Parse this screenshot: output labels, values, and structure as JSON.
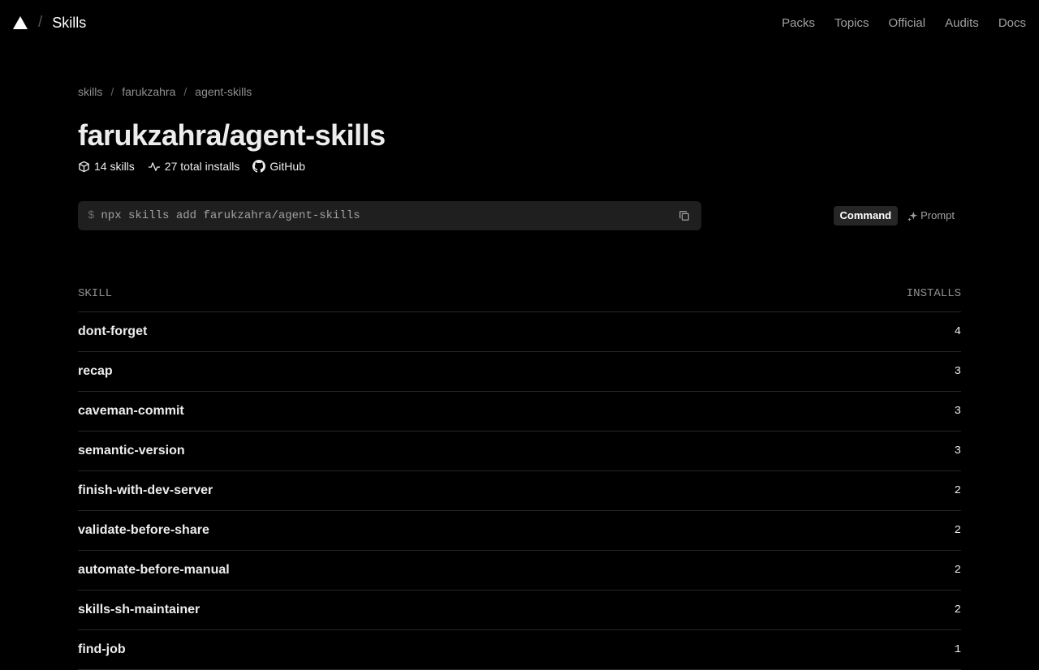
{
  "header": {
    "brand_sep": "/",
    "brand_name": "Skills",
    "nav": [
      "Packs",
      "Topics",
      "Official",
      "Audits",
      "Docs"
    ]
  },
  "breadcrumb": {
    "items": [
      "skills",
      "farukzahra",
      "agent-skills"
    ],
    "sep": "/"
  },
  "repo": {
    "title": "farukzahra/agent-skills",
    "skills_count": "14 skills",
    "installs": "27 total installs",
    "github_label": "GitHub"
  },
  "command": {
    "prompt_symbol": "$",
    "text": "npx skills add farukzahra/agent-skills"
  },
  "mode_toggle": {
    "command_label": "Command",
    "prompt_label": "Prompt"
  },
  "table": {
    "col_skill": "SKILL",
    "col_installs": "INSTALLS",
    "rows": [
      {
        "name": "dont-forget",
        "installs": "4"
      },
      {
        "name": "recap",
        "installs": "3"
      },
      {
        "name": "caveman-commit",
        "installs": "3"
      },
      {
        "name": "semantic-version",
        "installs": "3"
      },
      {
        "name": "finish-with-dev-server",
        "installs": "2"
      },
      {
        "name": "validate-before-share",
        "installs": "2"
      },
      {
        "name": "automate-before-manual",
        "installs": "2"
      },
      {
        "name": "skills-sh-maintainer",
        "installs": "2"
      },
      {
        "name": "find-job",
        "installs": "1"
      }
    ]
  },
  "colors": {
    "background": "#000000",
    "text": "#ededed",
    "muted": "#a1a1a1",
    "border": "#262626",
    "surface": "#1f1f1f"
  }
}
